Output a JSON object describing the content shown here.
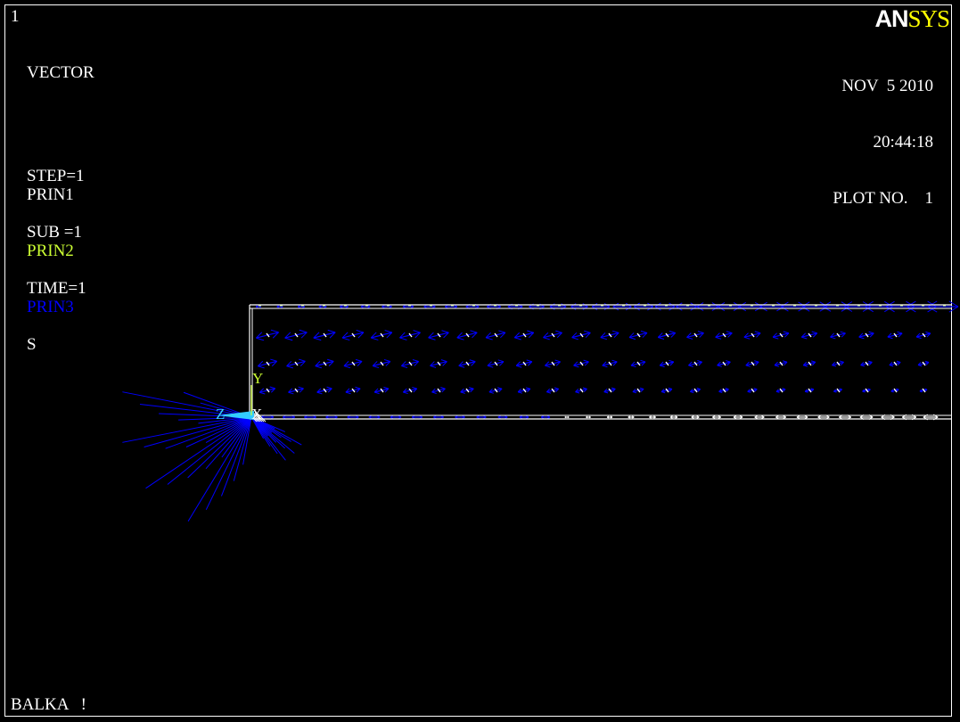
{
  "window": {
    "number": "1"
  },
  "logo": {
    "an": "AN",
    "sys": "SYS"
  },
  "info": {
    "plot_type": "VECTOR",
    "step": "STEP=1",
    "sub": "SUB =1",
    "time": "TIME=1",
    "item": "S"
  },
  "legend": [
    {
      "label": "PRIN1",
      "color": "#ffffff"
    },
    {
      "label": "PRIN2",
      "color": "#ccff33"
    },
    {
      "label": "PRIN3",
      "color": "#0000ff"
    }
  ],
  "stamp": {
    "date": "NOV  5 2010",
    "time": "20:44:18",
    "plot_no": "PLOT NO.    1"
  },
  "triad": {
    "x": "X",
    "y": "Y",
    "z": "Z"
  },
  "title": "BALKA   !",
  "colors": {
    "background": "#000000",
    "outline": "#ffffff",
    "prin1": "#ffffff",
    "prin2": "#ccff33",
    "prin3": "#0000ff",
    "triad_z": "#33ccff"
  }
}
